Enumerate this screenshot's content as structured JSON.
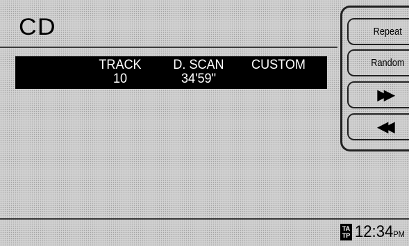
{
  "screen": {
    "title": "CD"
  },
  "info": {
    "track_label": "TRACK",
    "track_value": "10",
    "scan_label": "D. SCAN",
    "scan_value": "34'59\"",
    "custom_label": "CUSTOM"
  },
  "buttons": {
    "repeat": "Repeat",
    "random": "Random",
    "fast_forward_icon": "fast-forward-icon",
    "rewind_icon": "rewind-icon"
  },
  "status": {
    "ta_line1": "TA",
    "ta_line2": "TP",
    "time": "12:34",
    "ampm": "PM"
  }
}
